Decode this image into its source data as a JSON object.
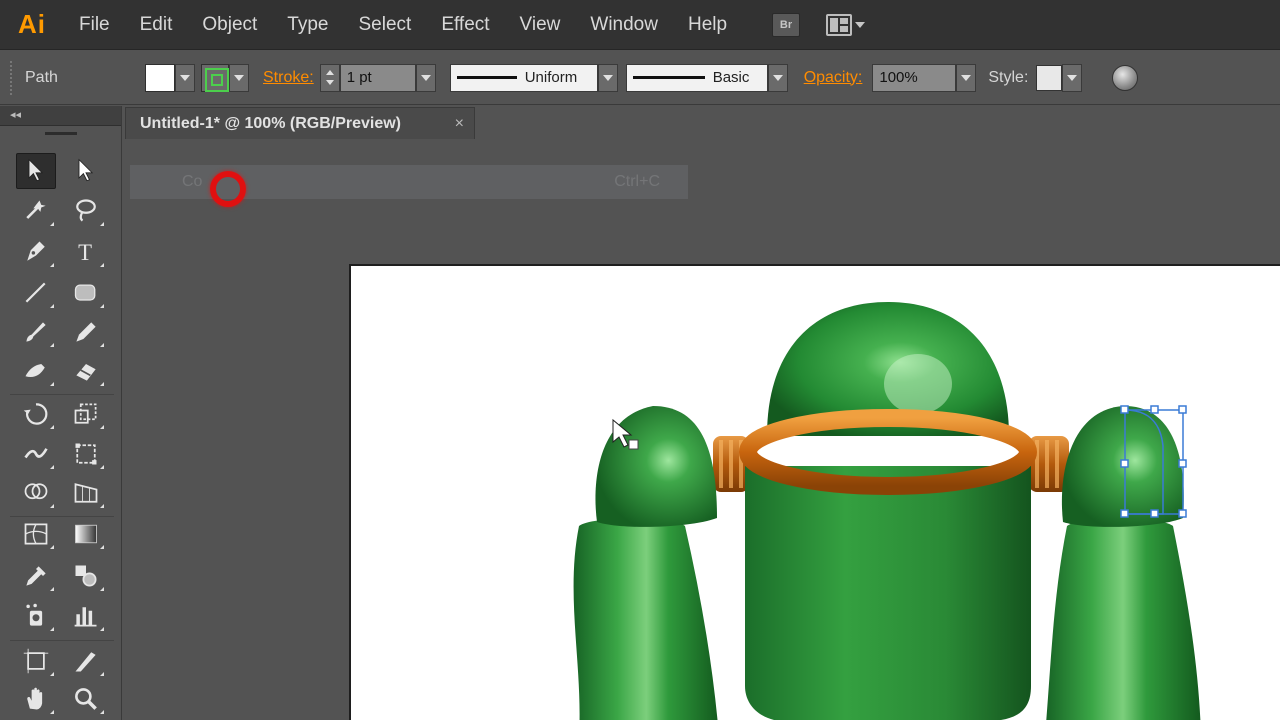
{
  "app": {
    "logo": "Ai",
    "menu": [
      "File",
      "Edit",
      "Object",
      "Type",
      "Select",
      "Effect",
      "View",
      "Window",
      "Help"
    ],
    "bridge_label": "Br"
  },
  "control_bar": {
    "selection_type": "Path",
    "stroke_label": "Stroke:",
    "stroke_weight": "1 pt",
    "variable_width_profile": "Uniform",
    "brush_definition": "Basic",
    "opacity_label": "Opacity:",
    "opacity_value": "100%",
    "style_label": "Style:",
    "fill_color": "#ffffff",
    "stroke_color": "#4ccf4c"
  },
  "document_tab": {
    "title": "Untitled-1* @ 100% (RGB/Preview)",
    "close": "×"
  },
  "context_menu_ghost": {
    "item": "Co",
    "shortcut": "Ctrl+C"
  },
  "tools": [
    "selection-tool",
    "direct-selection-tool",
    "magic-wand-tool",
    "lasso-tool",
    "pen-tool",
    "type-tool",
    "line-segment-tool",
    "rounded-rectangle-tool",
    "paintbrush-tool",
    "pencil-tool",
    "blob-brush-tool",
    "eraser-tool",
    "rotate-tool",
    "scale-tool",
    "width-tool",
    "free-transform-tool",
    "shape-builder-tool",
    "perspective-grid-tool",
    "mesh-tool",
    "gradient-tool",
    "eyedropper-tool",
    "blend-tool",
    "symbol-sprayer-tool",
    "column-graph-tool",
    "artboard-tool",
    "slice-tool",
    "hand-tool",
    "zoom-tool"
  ],
  "colors": {
    "robot_green": "#2e8b3a",
    "robot_orange": "#d9741a",
    "selection_blue": "#3a7bd5",
    "accent_orange": "#ff8c00"
  }
}
